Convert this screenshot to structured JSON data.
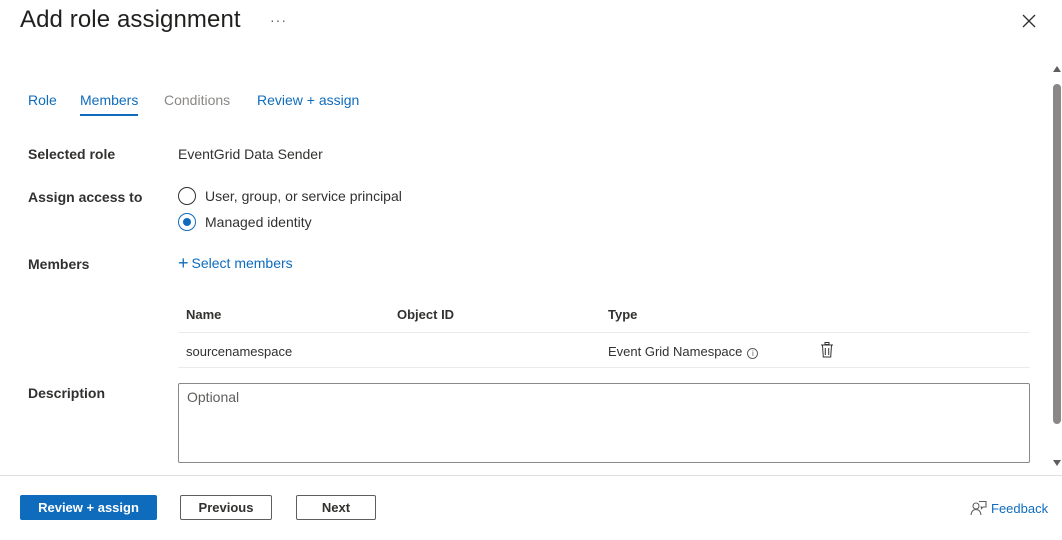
{
  "header": {
    "title": "Add role assignment",
    "more_label": "···"
  },
  "tabs": [
    {
      "label": "Role",
      "state": "normal"
    },
    {
      "label": "Members",
      "state": "active"
    },
    {
      "label": "Conditions",
      "state": "disabled"
    },
    {
      "label": "Review + assign",
      "state": "normal"
    }
  ],
  "form": {
    "selected_role_label": "Selected role",
    "selected_role_value": "EventGrid Data Sender",
    "assign_access_label": "Assign access to",
    "assign_options": [
      {
        "label": "User, group, or service principal",
        "checked": false
      },
      {
        "label": "Managed identity",
        "checked": true
      }
    ],
    "members_label": "Members",
    "select_members_label": "Select members",
    "description_label": "Description",
    "description_placeholder": "Optional",
    "description_value": ""
  },
  "members_table": {
    "columns": [
      "Name",
      "Object ID",
      "Type"
    ],
    "rows": [
      {
        "name": "sourcenamespace",
        "object_id": "",
        "type": "Event Grid Namespace"
      }
    ]
  },
  "footer": {
    "primary_label": "Review + assign",
    "previous_label": "Previous",
    "next_label": "Next",
    "feedback_label": "Feedback"
  },
  "colors": {
    "accent": "#0f6cbd",
    "text": "#323130",
    "disabled": "#8a8886"
  },
  "icons": {
    "close": "close-icon",
    "info": "info-icon",
    "delete": "trash-icon",
    "feedback": "feedback-icon",
    "add": "plus-icon"
  }
}
